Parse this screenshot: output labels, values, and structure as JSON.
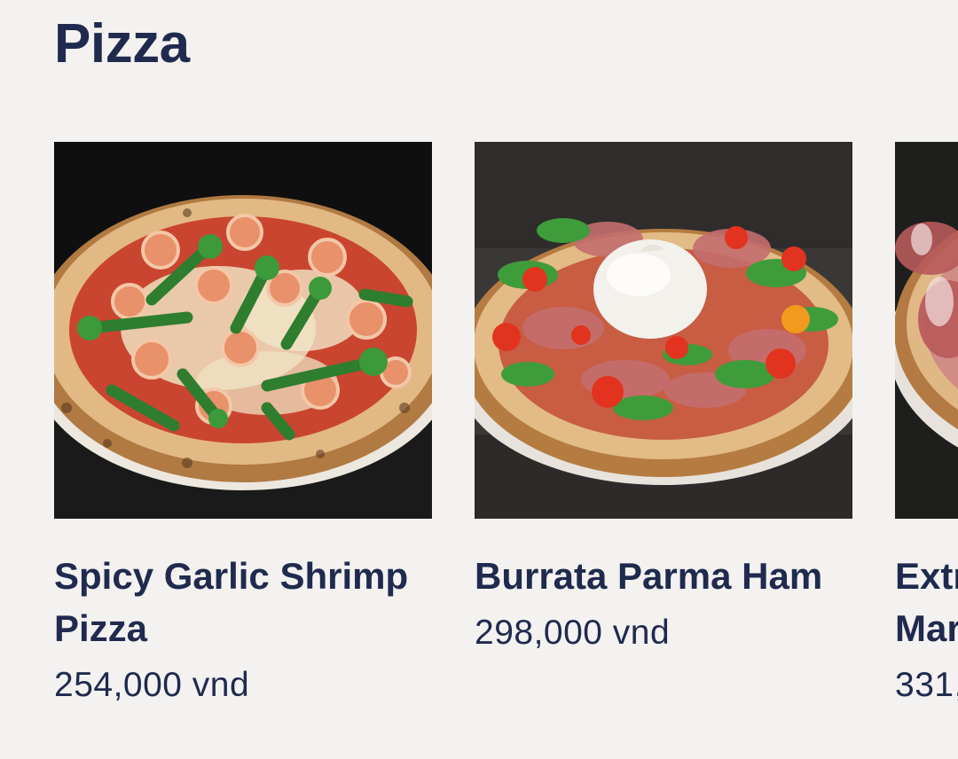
{
  "section": {
    "title": "Pizza"
  },
  "products": [
    {
      "name": "Spicy Garlic Shrimp Pizza",
      "price": "254,000 vnd",
      "image": "shrimp-pizza-photo"
    },
    {
      "name": "Burrata Parma Ham",
      "price": "298,000 vnd",
      "image": "burrata-pizza-photo"
    },
    {
      "name": "Extr Mar",
      "price": "331,",
      "image": "ham-pizza-photo"
    }
  ],
  "colors": {
    "background": "#f3f2f0",
    "text": "#1f2a4e"
  }
}
